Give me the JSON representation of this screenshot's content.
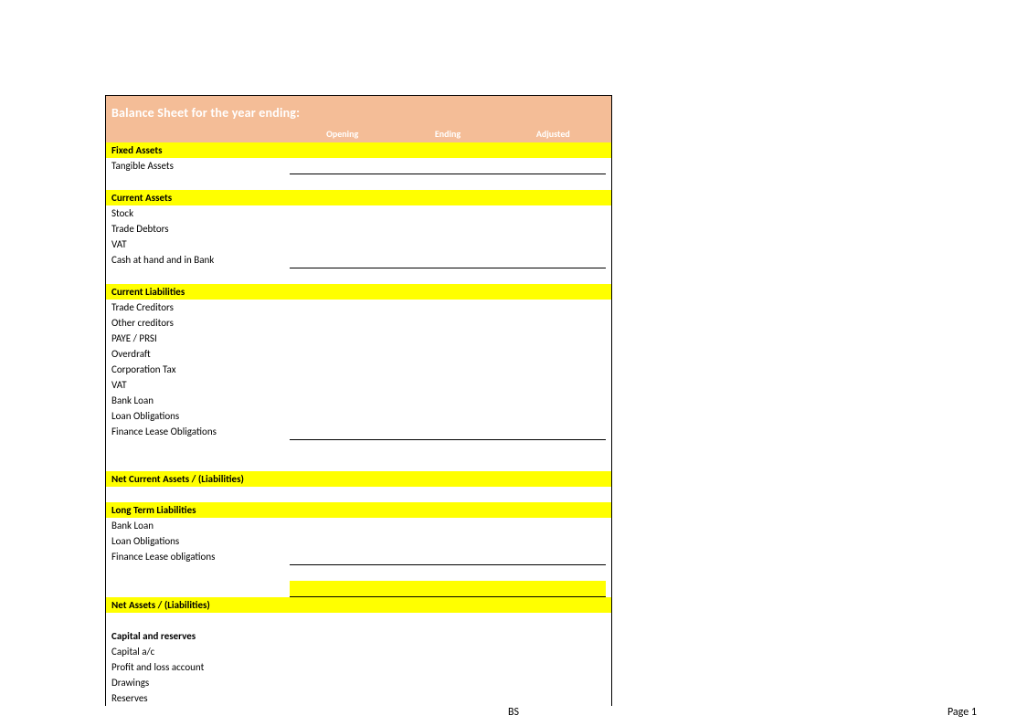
{
  "colors": {
    "header_bg": "#f4bd97",
    "section_bg": "#ffff00"
  },
  "header": {
    "title": "Balance Sheet for the year ending:",
    "columns": [
      "Opening",
      "Ending",
      "Adjusted"
    ]
  },
  "sections": {
    "fixed_assets": {
      "heading": "Fixed Assets",
      "items": [
        "Tangible Assets"
      ]
    },
    "current_assets": {
      "heading": "Current Assets",
      "items": [
        "Stock",
        "Trade Debtors",
        "VAT",
        "Cash at hand and in Bank"
      ]
    },
    "current_liabilities": {
      "heading": "Current Liabilities",
      "items": [
        "Trade Creditors",
        "Other creditors",
        "PAYE / PRSI",
        "Overdraft",
        "Corporation Tax",
        "VAT",
        "Bank Loan",
        "Loan Obligations",
        "Finance Lease Obligations"
      ]
    },
    "net_current": {
      "heading": "Net Current Assets / (Liabilities)"
    },
    "long_term_liabilities": {
      "heading": "Long Term Liabilities",
      "items": [
        "Bank Loan",
        "Loan Obligations",
        "Finance Lease obligations"
      ]
    },
    "net_assets": {
      "heading": "Net Assets / (Liabilities)"
    },
    "capital_reserves": {
      "heading": "Capital and reserves",
      "items": [
        "Capital a/c",
        "Profit and loss account",
        "Drawings",
        "Reserves"
      ]
    }
  },
  "footer": {
    "center": "BS",
    "right": "Page 1"
  }
}
